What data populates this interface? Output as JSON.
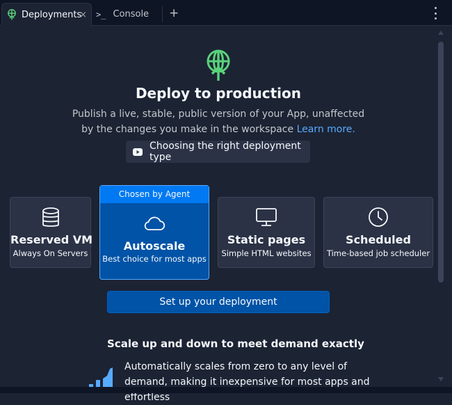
{
  "tabs": [
    {
      "label": "Deployments",
      "close": "×"
    },
    {
      "label": "Console",
      "icon_text": ">_"
    }
  ],
  "add_tab": "+",
  "hero": {
    "title": "Deploy to production",
    "description": "Publish a live, stable, public version of your App, unaffected by the changes you make in the workspace",
    "learn_more": "Learn more.",
    "video_button": "Choosing the right deployment type"
  },
  "deployment_types": [
    {
      "name": "Reserved VM",
      "desc": "Always On Servers",
      "icon": "database-icon"
    },
    {
      "name": "Autoscale",
      "desc": "Best choice for most apps",
      "icon": "cloud-icon",
      "badge": "Chosen by Agent",
      "selected": true
    },
    {
      "name": "Static pages",
      "desc": "Simple HTML websites",
      "icon": "monitor-icon"
    },
    {
      "name": "Scheduled",
      "desc": "Time-based job scheduler",
      "icon": "clock-icon"
    }
  ],
  "setup_button": "Set up your deployment",
  "section": {
    "title": "Scale up and down to meet demand exactly",
    "body": "Automatically scales from zero to any level of demand, making it inexpensive for most apps and effortless"
  },
  "colors": {
    "background": "#1c2333",
    "tabbar": "#0e1525",
    "accent_green": "#59d37a",
    "primary_blue": "#0053a6",
    "badge_blue": "#0079f2",
    "link": "#57abff"
  }
}
